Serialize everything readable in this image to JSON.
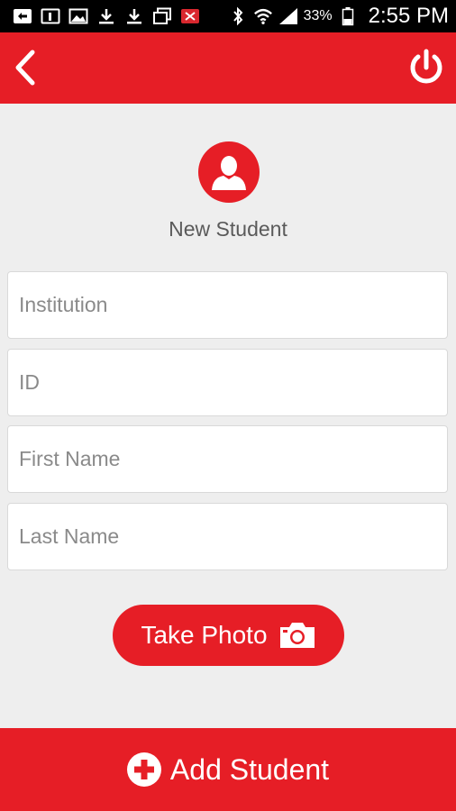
{
  "status_bar": {
    "battery_pct": "33%",
    "time": "2:55 PM"
  },
  "page": {
    "title": "New Student"
  },
  "form": {
    "institution_placeholder": "Institution",
    "id_placeholder": "ID",
    "first_name_placeholder": "First Name",
    "last_name_placeholder": "Last Name"
  },
  "actions": {
    "take_photo_label": "Take Photo",
    "add_student_label": "Add Student"
  },
  "icons": {
    "back": "chevron-left-icon",
    "power": "power-icon",
    "avatar": "person-icon",
    "camera": "camera-icon",
    "add": "plus-circle-icon"
  },
  "colors": {
    "accent": "#e61e26",
    "background": "#eeeeee",
    "field_bg": "#ffffff",
    "placeholder": "#8a8a8a"
  }
}
